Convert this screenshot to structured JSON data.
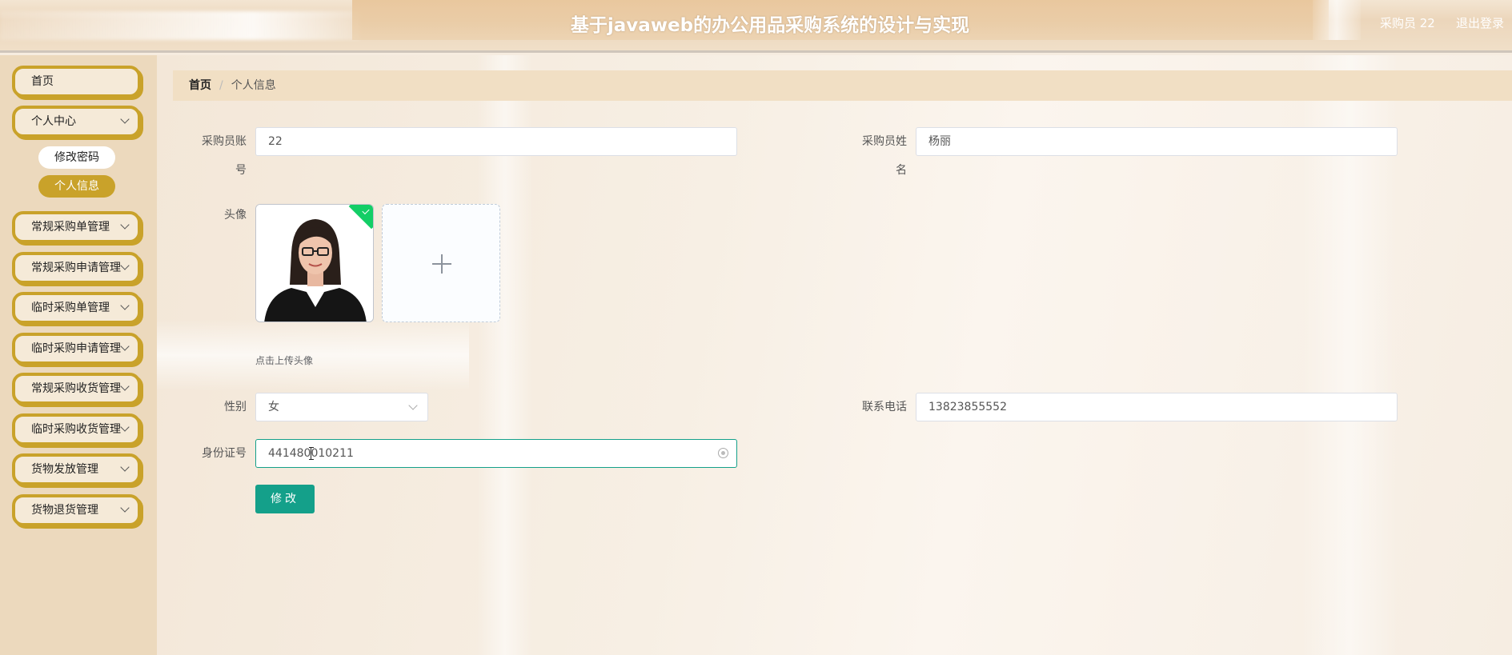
{
  "header": {
    "title": "基于javaweb的办公用品采购系统的设计与实现",
    "user": "采购员 22",
    "logout": "退出登录"
  },
  "sidebar": {
    "items": [
      {
        "label": "首页"
      },
      {
        "label": "个人中心",
        "sub": [
          "修改密码",
          "个人信息"
        ]
      },
      {
        "label": "常规采购单管理"
      },
      {
        "label": "常规采购申请管理"
      },
      {
        "label": "临时采购单管理"
      },
      {
        "label": "临时采购申请管理"
      },
      {
        "label": "常规采购收货管理"
      },
      {
        "label": "临时采购收货管理"
      },
      {
        "label": "货物发放管理"
      },
      {
        "label": "货物退货管理"
      }
    ]
  },
  "breadcrumb": {
    "home": "首页",
    "separator": "/",
    "current": "个人信息"
  },
  "form": {
    "account_label_1": "采购员账",
    "account_label_2": "号",
    "account_value": "22",
    "name_label_1": "采购员姓",
    "name_label_2": "名",
    "name_value": "杨丽",
    "avatar_label": "头像",
    "avatar_tip": "点击上传头像",
    "gender_label": "性别",
    "gender_value": "女",
    "phone_label": "联系电话",
    "phone_value": "13823855552",
    "idcard_label": "身份证号",
    "idcard_value": "441480010211",
    "submit_label": "修改"
  },
  "colors": {
    "accent": "#c9a22a",
    "primary_button": "#14a08a",
    "success_mark": "#13ce66"
  }
}
